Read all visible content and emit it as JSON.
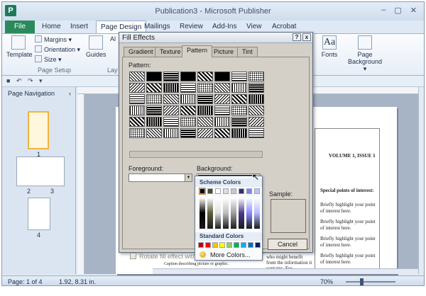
{
  "window": {
    "title": "Publication3 - Microsoft Publisher",
    "app_letter": "P",
    "controls": [
      "–",
      "▢",
      "✕"
    ]
  },
  "ribbon_tabs": {
    "file": "File",
    "items": [
      "Home",
      "Insert",
      "Page Design",
      "Mailings",
      "Review",
      "Add-Ins",
      "View",
      "Acrobat"
    ],
    "active": "Page Design"
  },
  "ribbon": {
    "template": "Template",
    "margins": "Margins ▾",
    "orientation": "Orientation ▾",
    "size": "Size ▾",
    "page_setup": "Page Setup",
    "guides": "Guides",
    "partial_al": "Al",
    "partial_lay": "Lay",
    "fonts": "Fonts",
    "page_background": "Page Background ▾"
  },
  "nav_pane": {
    "title": "Page Navigation",
    "collapse": "‹",
    "pages": [
      "1",
      "2",
      "3",
      "4"
    ]
  },
  "dialog": {
    "title": "Fill Effects",
    "help": "?",
    "close": "x",
    "tabs": [
      "Gradient",
      "Texture",
      "Pattern",
      "Picture",
      "Tint"
    ],
    "active_tab": "Pattern",
    "pattern_label": "Pattern:",
    "foreground_label": "Foreground:",
    "background_label": "Background:",
    "sample_label": "Sample:",
    "rotate_label": "Rotate fill effect with sha",
    "cancel": "Cancel"
  },
  "color_popup": {
    "scheme_title": "Scheme Colors",
    "scheme_colors": [
      "#000000",
      "#4a4a2a",
      "#ffffff",
      "#dcdcdc",
      "#c8c8c8",
      "#3a2a70",
      "#8080ff",
      "#c0c0ff"
    ],
    "standard_title": "Standard Colors",
    "standard_colors": [
      "#c00000",
      "#ff0000",
      "#ffc000",
      "#ffff00",
      "#92d050",
      "#00b050",
      "#00b0f0",
      "#0070c0",
      "#002060"
    ],
    "more": "More Colors..."
  },
  "document": {
    "volume": "VOLUME 1, ISSUE 1",
    "special_points": "Special points of interest:",
    "bullets": [
      "Briefly highlight your point of interest here.",
      "Briefly highlight your point of interest here.",
      "Briefly highlight your point of interest here.",
      "Briefly highlight your point of interest here."
    ],
    "body_snippet": "who might benefit from the information it contains. For",
    "caption": "Caption describing picture or graphic."
  },
  "status": {
    "page": "Page: 1 of 4",
    "position": "1.92, 8.31 in.",
    "zoom": "70%"
  }
}
